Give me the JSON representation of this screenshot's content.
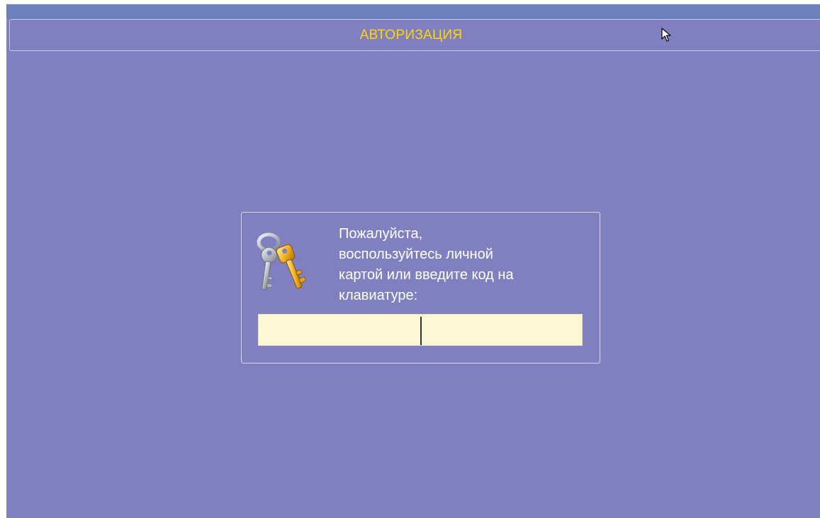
{
  "header": {
    "title": "АВТОРИЗАЦИЯ",
    "title_color": "#ffd700"
  },
  "colors": {
    "background": "#8080c0",
    "top_strip": "#6d80be",
    "input_background": "#fff8d6"
  },
  "dialog": {
    "icon": "keys-icon",
    "message": "Пожалуйста,\nвоспользуйтесь личной\nкартой или введите  код на\nклавиатуре:",
    "code_input": {
      "value": "",
      "placeholder": ""
    }
  },
  "cursor": {
    "icon": "mouse-pointer-icon"
  }
}
